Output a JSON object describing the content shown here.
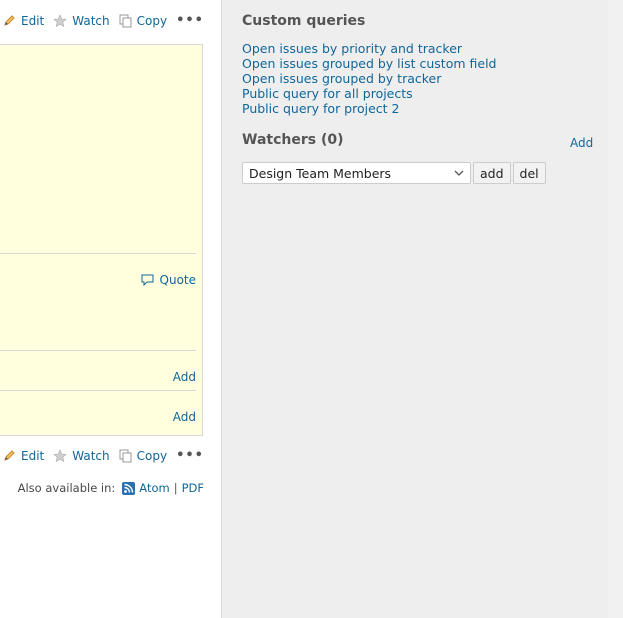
{
  "actions": {
    "edit": "Edit",
    "watch": "Watch",
    "copy": "Copy",
    "more": "•••"
  },
  "issue": {
    "quote": "Quote",
    "add_related": "Add",
    "add_subtask": "Add"
  },
  "formats": {
    "label": "Also available in:",
    "atom": "Atom",
    "separator": "|",
    "pdf": "PDF"
  },
  "sidebar": {
    "custom_queries_title": "Custom queries",
    "queries": [
      "Open issues by priority and tracker",
      "Open issues grouped by list custom field",
      "Open issues grouped by tracker",
      "Public query for all projects",
      "Public query for project 2"
    ],
    "watchers_title": "Watchers (0)",
    "watchers_add": "Add",
    "watcher_select_value": "Design Team Members",
    "add_button": "add",
    "del_button": "del"
  },
  "colors": {
    "link": "#116699",
    "issue_background": "#ffffdd",
    "sidebar_background": "#eeeeee"
  }
}
